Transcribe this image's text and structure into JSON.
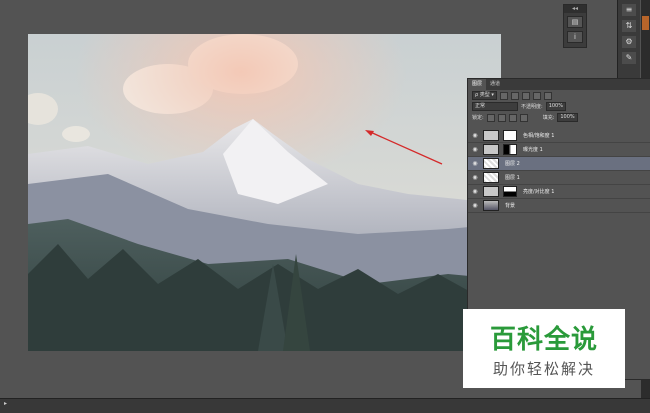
{
  "layers_panel": {
    "tabs": [
      "图层",
      "通道"
    ],
    "blend_mode": "正常",
    "opacity_label": "不透明度:",
    "opacity_value": "100%",
    "lock_label": "锁定:",
    "fill_label": "填充:",
    "fill_value": "100%",
    "layers": [
      {
        "name": "色相/饱和度 1",
        "selected": false
      },
      {
        "name": "曝光度 1",
        "selected": false
      },
      {
        "name": "图层 2",
        "selected": true
      },
      {
        "name": "图层 1",
        "selected": false
      },
      {
        "name": "亮度/对比度 1",
        "selected": false
      },
      {
        "name": "背景",
        "selected": false
      }
    ]
  },
  "watermark": {
    "title": "百科全说",
    "subtitle": "助你轻松解决"
  },
  "info_panel": {
    "icon": "i"
  },
  "colors": {
    "annotation": "#d42a2a",
    "brand_green": "#2a9a3a"
  }
}
